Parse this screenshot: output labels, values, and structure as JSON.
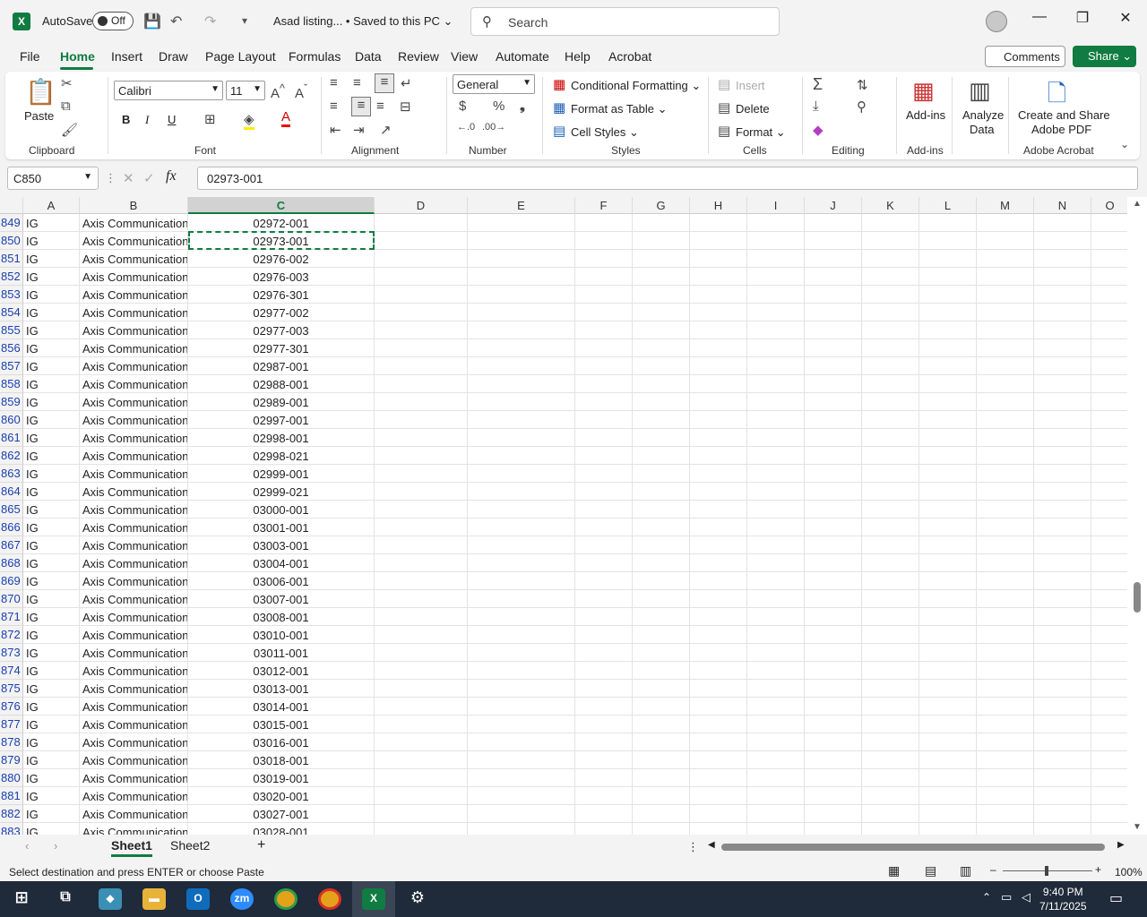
{
  "titlebar": {
    "autosave_label": "AutoSave",
    "toggle_state": "Off",
    "doc_title": "Asad listing...  •  Saved to this PC ⌄",
    "search_placeholder": "Search"
  },
  "menu": [
    "File",
    "Home",
    "Insert",
    "Draw",
    "Page Layout",
    "Formulas",
    "Data",
    "Review",
    "View",
    "Automate",
    "Help",
    "Acrobat"
  ],
  "buttons": {
    "comments": "Comments",
    "share": "Share ⌄"
  },
  "ribbon": {
    "clipboard": {
      "paste": "Paste",
      "label": "Clipboard"
    },
    "font": {
      "name": "Calibri",
      "size": "11",
      "label": "Font"
    },
    "alignment": {
      "label": "Alignment"
    },
    "number": {
      "format": "General",
      "label": "Number"
    },
    "styles": {
      "conditional": "Conditional Formatting ⌄",
      "table": "Format as Table ⌄",
      "cell": "Cell Styles ⌄",
      "label": "Styles"
    },
    "cells": {
      "insert": "Insert",
      "delete": "Delete",
      "format": "Format ⌄",
      "label": "Cells"
    },
    "editing": {
      "label": "Editing"
    },
    "addins": {
      "btn": "Add-ins",
      "label": "Add-ins"
    },
    "analyze": {
      "line1": "Analyze",
      "line2": "Data"
    },
    "acrobat": {
      "line1": "Create and Share",
      "line2": "Adobe PDF",
      "label": "Adobe Acrobat"
    }
  },
  "formula_bar": {
    "name_box": "C850",
    "formula": "02973-001"
  },
  "columns": [
    "A",
    "B",
    "C",
    "D",
    "E",
    "F",
    "G",
    "H",
    "I",
    "J",
    "K",
    "L",
    "M",
    "N",
    "O"
  ],
  "rows": [
    {
      "n": "849",
      "a": "IG",
      "b": "Axis Communications",
      "c": "02972-001"
    },
    {
      "n": "850",
      "a": "IG",
      "b": "Axis Communications",
      "c": "02973-001"
    },
    {
      "n": "851",
      "a": "IG",
      "b": "Axis Communications",
      "c": "02976-002"
    },
    {
      "n": "852",
      "a": "IG",
      "b": "Axis Communications",
      "c": "02976-003"
    },
    {
      "n": "853",
      "a": "IG",
      "b": "Axis Communications",
      "c": "02976-301"
    },
    {
      "n": "854",
      "a": "IG",
      "b": "Axis Communications",
      "c": "02977-002"
    },
    {
      "n": "855",
      "a": "IG",
      "b": "Axis Communications",
      "c": "02977-003"
    },
    {
      "n": "856",
      "a": "IG",
      "b": "Axis Communications",
      "c": "02977-301"
    },
    {
      "n": "857",
      "a": "IG",
      "b": "Axis Communications",
      "c": "02987-001"
    },
    {
      "n": "858",
      "a": "IG",
      "b": "Axis Communications",
      "c": "02988-001"
    },
    {
      "n": "859",
      "a": "IG",
      "b": "Axis Communications",
      "c": "02989-001"
    },
    {
      "n": "860",
      "a": "IG",
      "b": "Axis Communications",
      "c": "02997-001"
    },
    {
      "n": "861",
      "a": "IG",
      "b": "Axis Communications",
      "c": "02998-001"
    },
    {
      "n": "862",
      "a": "IG",
      "b": "Axis Communications",
      "c": "02998-021"
    },
    {
      "n": "863",
      "a": "IG",
      "b": "Axis Communications",
      "c": "02999-001"
    },
    {
      "n": "864",
      "a": "IG",
      "b": "Axis Communications",
      "c": "02999-021"
    },
    {
      "n": "865",
      "a": "IG",
      "b": "Axis Communications",
      "c": "03000-001"
    },
    {
      "n": "866",
      "a": "IG",
      "b": "Axis Communications",
      "c": "03001-001"
    },
    {
      "n": "867",
      "a": "IG",
      "b": "Axis Communications",
      "c": "03003-001"
    },
    {
      "n": "868",
      "a": "IG",
      "b": "Axis Communications",
      "c": "03004-001"
    },
    {
      "n": "869",
      "a": "IG",
      "b": "Axis Communications",
      "c": "03006-001"
    },
    {
      "n": "870",
      "a": "IG",
      "b": "Axis Communications",
      "c": "03007-001"
    },
    {
      "n": "871",
      "a": "IG",
      "b": "Axis Communications",
      "c": "03008-001"
    },
    {
      "n": "872",
      "a": "IG",
      "b": "Axis Communications",
      "c": "03010-001"
    },
    {
      "n": "873",
      "a": "IG",
      "b": "Axis Communications",
      "c": "03011-001"
    },
    {
      "n": "874",
      "a": "IG",
      "b": "Axis Communications",
      "c": "03012-001"
    },
    {
      "n": "875",
      "a": "IG",
      "b": "Axis Communications",
      "c": "03013-001"
    },
    {
      "n": "876",
      "a": "IG",
      "b": "Axis Communications",
      "c": "03014-001"
    },
    {
      "n": "877",
      "a": "IG",
      "b": "Axis Communications",
      "c": "03015-001"
    },
    {
      "n": "878",
      "a": "IG",
      "b": "Axis Communications",
      "c": "03016-001"
    },
    {
      "n": "879",
      "a": "IG",
      "b": "Axis Communications",
      "c": "03018-001"
    },
    {
      "n": "880",
      "a": "IG",
      "b": "Axis Communications",
      "c": "03019-001"
    },
    {
      "n": "881",
      "a": "IG",
      "b": "Axis Communications",
      "c": "03020-001"
    },
    {
      "n": "882",
      "a": "IG",
      "b": "Axis Communications",
      "c": "03027-001"
    },
    {
      "n": "883",
      "a": "IG",
      "b": "Axis Communications",
      "c": "03028-001"
    }
  ],
  "sheets": [
    "Sheet1",
    "Sheet2"
  ],
  "status": {
    "message": "Select destination and press ENTER or choose Paste",
    "zoom": "100%"
  },
  "taskbar": {
    "time": "9:40 PM",
    "date": "7/11/2025"
  },
  "colors": {
    "accent": "#107c41",
    "rownum": "#1a3fb0"
  }
}
